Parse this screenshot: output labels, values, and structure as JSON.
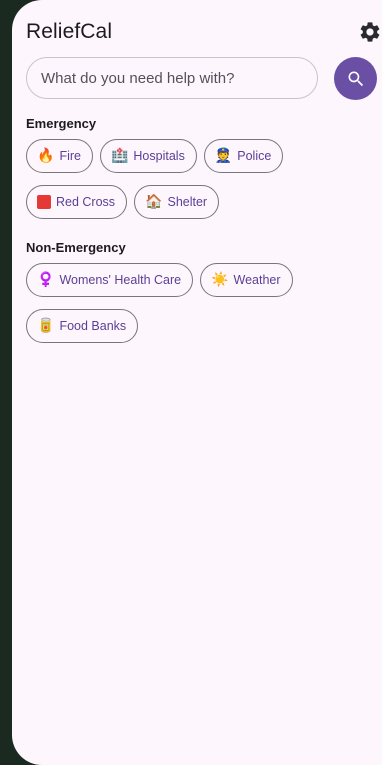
{
  "app": {
    "title": "ReliefCal",
    "settings_icon": "gear-icon"
  },
  "search": {
    "placeholder": "What do you need help with?",
    "value": "",
    "button_icon": "search-icon"
  },
  "sections": {
    "emergency": {
      "label": "Emergency",
      "chips": [
        {
          "emoji": "🔥",
          "label": "Fire",
          "icon": "fire-icon"
        },
        {
          "emoji": "🏥",
          "label": "Hospitals",
          "icon": "hospital-icon"
        },
        {
          "emoji": "👮",
          "label": "Police",
          "icon": "police-officer-icon"
        },
        {
          "emoji": "🟥",
          "label": "Red Cross",
          "icon": "red-square-icon"
        },
        {
          "emoji": "🏠",
          "label": "Shelter",
          "icon": "house-icon"
        }
      ]
    },
    "non_emergency": {
      "label": "Non-Emergency",
      "chips": [
        {
          "emoji": "♀️",
          "label": "Womens' Health Care",
          "icon": "female-sign-icon"
        },
        {
          "emoji": "☀️",
          "label": "Weather",
          "icon": "sun-icon"
        },
        {
          "emoji": "🥫",
          "label": "Food Banks",
          "icon": "canned-food-icon"
        }
      ]
    }
  },
  "colors": {
    "accent": "#6b4fa5",
    "chip_text": "#5b3f96",
    "background": "#fdf6fd",
    "frame": "#1b2a20"
  }
}
